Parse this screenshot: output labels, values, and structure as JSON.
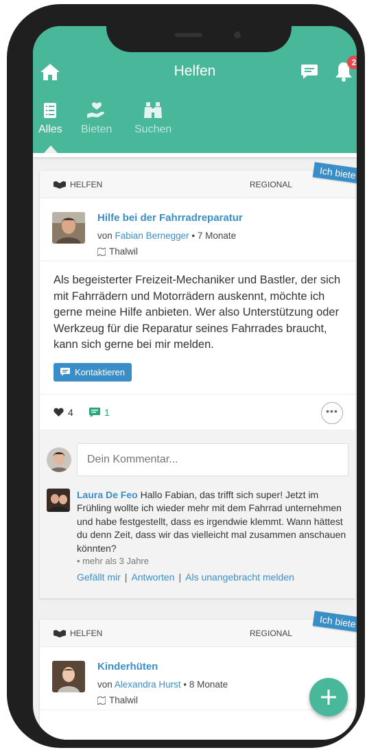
{
  "header": {
    "title": "Helfen",
    "notification_count": "2",
    "tabs": [
      {
        "label": "Alles",
        "icon": "list-icon",
        "active": true
      },
      {
        "label": "Bieten",
        "icon": "heart-hand-icon",
        "active": false
      },
      {
        "label": "Suchen",
        "icon": "binoculars-icon",
        "active": false
      }
    ]
  },
  "posts": [
    {
      "type_label": "HELFEN",
      "region_label": "REGIONAL",
      "ribbon": "Ich biete",
      "title": "Hilfe bei der Fahrradreparatur",
      "by_prefix": "von",
      "author": "Fabian Bernegger",
      "age": "• 7 Monate",
      "location": "Thalwil",
      "body": "Als begeisterter Freizeit-Mechaniker und Bastler, der sich mit Fahrrädern und Motorrädern auskennt, möchte ich gerne meine Hilfe anbieten. Wer also Unterstützung oder Werkzeug für die Reparatur seines Fahrrades braucht, kann sich gerne bei mir melden.",
      "contact_label": "Kontaktieren",
      "likes": "4",
      "comments": "1",
      "comment_placeholder": "Dein Kommentar...",
      "comment": {
        "author": "Laura De Feo",
        "text": "Hallo Fabian, das trifft sich super! Jetzt im Frühling wollte ich wieder mehr mit dem Fahrrad unternehmen und habe festgestellt, dass es irgendwie klemmt. Wann hättest du denn Zeit, dass wir das vielleicht mal zusammen anschauen könnten?",
        "time": "• mehr als 3 Jahre",
        "like_action": "Gefällt mir",
        "reply_action": "Antworten",
        "report_action": "Als unangebracht melden"
      }
    },
    {
      "type_label": "HELFEN",
      "region_label": "REGIONAL",
      "ribbon": "Ich biete",
      "title": "Kinderhüten",
      "by_prefix": "von",
      "author": "Alexandra Hurst",
      "age": "• 8 Monate",
      "location": "Thalwil"
    }
  ],
  "colors": {
    "brand_green": "#48b79a",
    "link_blue": "#3a8ec8",
    "badge_red": "#e5484d"
  }
}
